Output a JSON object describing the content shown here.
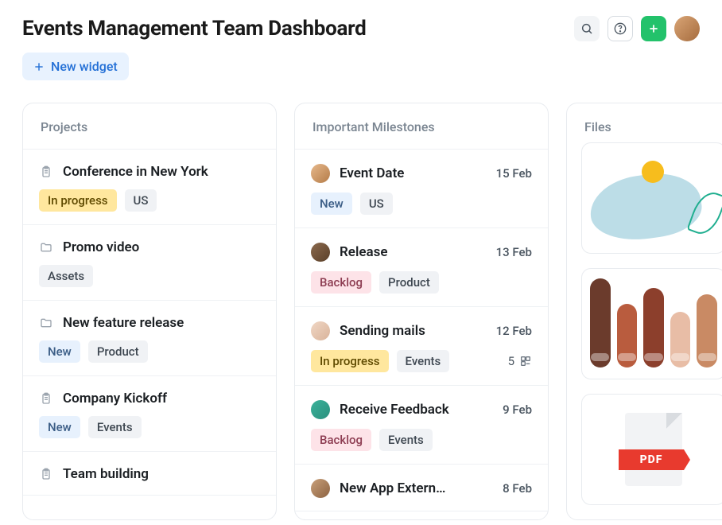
{
  "header": {
    "title": "Events Management Team Dashboard",
    "new_widget_label": "New widget"
  },
  "projects": {
    "header": "Projects",
    "items": [
      {
        "icon": "clipboard",
        "name": "Conference in New York",
        "tags": [
          {
            "label": "In progress",
            "kind": "inprogress"
          },
          {
            "label": "US",
            "kind": "plain"
          }
        ]
      },
      {
        "icon": "folder",
        "name": "Promo video",
        "tags": [
          {
            "label": "Assets",
            "kind": "plain"
          }
        ]
      },
      {
        "icon": "folder",
        "name": "New feature release",
        "tags": [
          {
            "label": "New",
            "kind": "new"
          },
          {
            "label": "Product",
            "kind": "plain"
          }
        ]
      },
      {
        "icon": "clipboard",
        "name": "Company Kickoff",
        "tags": [
          {
            "label": "New",
            "kind": "new"
          },
          {
            "label": "Events",
            "kind": "plain"
          }
        ]
      },
      {
        "icon": "clipboard",
        "name": "Team building",
        "tags": []
      }
    ]
  },
  "milestones": {
    "header": "Important Milestones",
    "items": [
      {
        "avatar": "av1",
        "name": "Event Date",
        "date": "15 Feb",
        "tags": [
          {
            "label": "New",
            "kind": "new"
          },
          {
            "label": "US",
            "kind": "plain"
          }
        ],
        "subtasks": null
      },
      {
        "avatar": "av2",
        "name": "Release",
        "date": "13 Feb",
        "tags": [
          {
            "label": "Backlog",
            "kind": "backlog"
          },
          {
            "label": "Product",
            "kind": "plain"
          }
        ],
        "subtasks": null
      },
      {
        "avatar": "av3",
        "name": "Sending mails",
        "date": "12 Feb",
        "tags": [
          {
            "label": "In progress",
            "kind": "inprogress"
          },
          {
            "label": "Events",
            "kind": "plain"
          }
        ],
        "subtasks": "5"
      },
      {
        "avatar": "av4",
        "name": "Receive Feedback",
        "date": "9 Feb",
        "tags": [
          {
            "label": "Backlog",
            "kind": "backlog"
          },
          {
            "label": "Events",
            "kind": "plain"
          }
        ],
        "subtasks": null
      },
      {
        "avatar": "av5",
        "name": "New App Extern…",
        "date": "8 Feb",
        "tags": [],
        "subtasks": null
      }
    ]
  },
  "files": {
    "header": "Files",
    "pdf_label": "PDF"
  }
}
